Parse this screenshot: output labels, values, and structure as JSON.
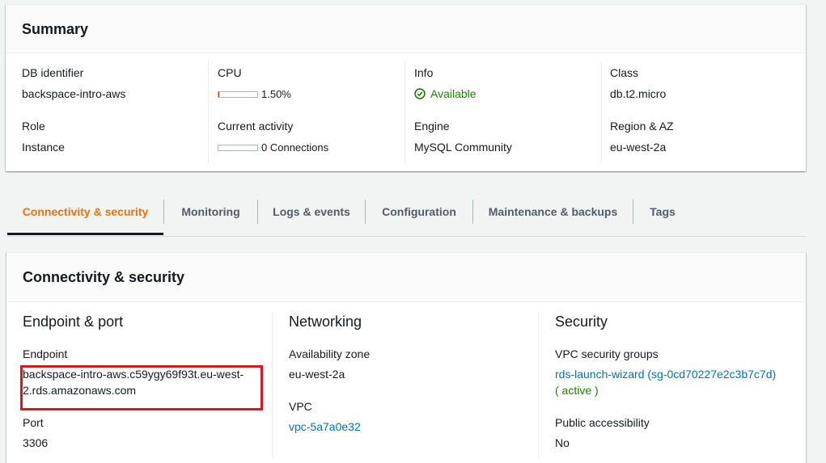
{
  "summary": {
    "title": "Summary",
    "db_identifier": {
      "label": "DB identifier",
      "value": "backspace-intro-aws"
    },
    "role": {
      "label": "Role",
      "value": "Instance"
    },
    "cpu": {
      "label": "CPU",
      "value": "1.50%",
      "fraction": 0.015
    },
    "current_activity": {
      "label": "Current activity",
      "value": "0 Connections",
      "fraction": 0.0
    },
    "info": {
      "label": "Info",
      "value": "Available",
      "status_color": "#1d8102",
      "icon": "check-circle-icon"
    },
    "engine": {
      "label": "Engine",
      "value": "MySQL Community"
    },
    "class": {
      "label": "Class",
      "value": "db.t2.micro"
    },
    "region_az": {
      "label": "Region & AZ",
      "value": "eu-west-2a"
    }
  },
  "tabs": [
    {
      "label": "Connectivity & security",
      "active": true
    },
    {
      "label": "Monitoring"
    },
    {
      "label": "Logs & events"
    },
    {
      "label": "Configuration"
    },
    {
      "label": "Maintenance & backups"
    },
    {
      "label": "Tags"
    }
  ],
  "connectivity": {
    "title": "Connectivity & security",
    "endpoint_port": {
      "title": "Endpoint & port",
      "endpoint_label": "Endpoint",
      "endpoint_line1": "backspace-intro-aws.c59ygy69f93t.eu-west-",
      "endpoint_line2": "2.rds.amazonaws.com",
      "port_label": "Port",
      "port_value": "3306"
    },
    "networking": {
      "title": "Networking",
      "az_label": "Availability zone",
      "az_value": "eu-west-2a",
      "vpc_label": "VPC",
      "vpc_value": "vpc-5a7a0e32"
    },
    "security": {
      "title": "Security",
      "sg_label": "VPC security groups",
      "sg_value": "rds-launch-wizard (sg-0cd70227e2c3b7c7d)",
      "sg_status": "( active )",
      "public_label": "Public accessibility",
      "public_value": "No"
    }
  },
  "colors": {
    "accent_orange": "#ec7211",
    "link_blue": "#0073bb",
    "status_green": "#1d8102",
    "highlight_red": "#e0141e"
  }
}
